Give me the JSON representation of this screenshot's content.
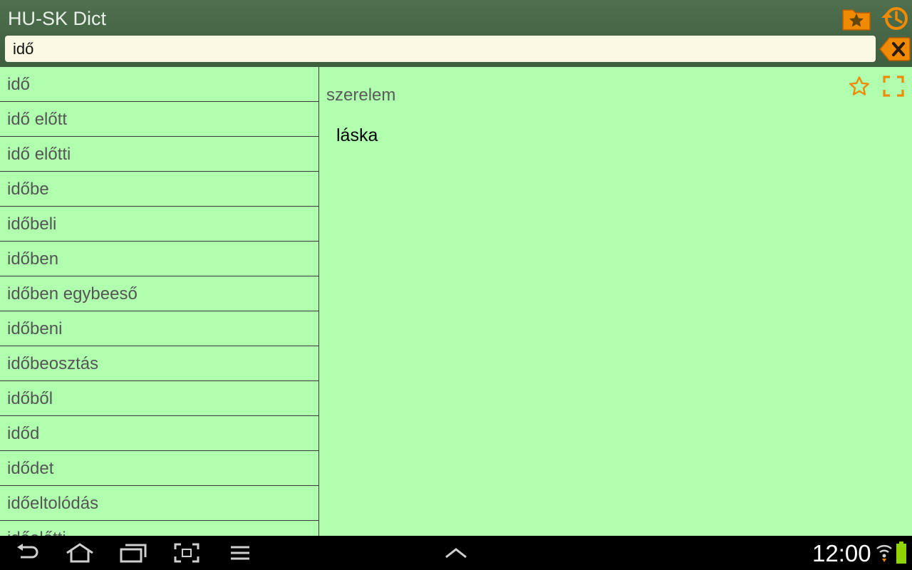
{
  "header": {
    "title": "HU-SK Dict",
    "favorites_icon": "folder-star-icon",
    "history_icon": "history-icon",
    "accent_color": "#f08a00"
  },
  "search": {
    "value": "idő",
    "clear_icon": "backspace-clear-icon"
  },
  "word_list": {
    "items": [
      "idő",
      "idő előtt",
      "idő előtti",
      "időbe",
      "időbeli",
      "időben",
      "időben egybeeső",
      "időbeni",
      "időbeosztás",
      "időből",
      "időd",
      "idődet",
      "időeltolódás",
      "időelőtti"
    ]
  },
  "detail": {
    "headword": "szerelem",
    "translation": "láska",
    "star_icon": "star-outline-icon",
    "fullscreen_icon": "fullscreen-icon"
  },
  "navbar": {
    "buttons": [
      "back-icon",
      "home-icon",
      "recent-apps-icon",
      "screenshot-icon",
      "menu-icon",
      "up-chevron-icon"
    ],
    "time": "12:00",
    "background": "#000000"
  },
  "colors": {
    "background": "#afffaf",
    "header": "#4a6a4a",
    "search_bg": "#fbf8e4"
  }
}
